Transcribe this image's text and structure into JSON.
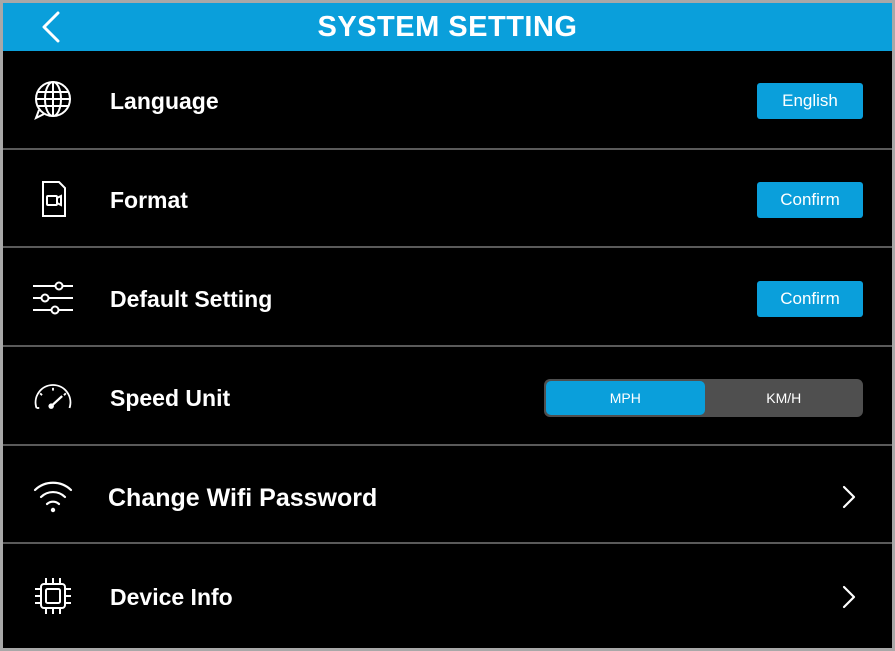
{
  "header": {
    "title": "SYSTEM SETTING",
    "back_icon": "chevron-left-icon"
  },
  "rows": [
    {
      "icon": "globe-icon",
      "label": "Language",
      "control": "button",
      "button_label": "English"
    },
    {
      "icon": "video-file-icon",
      "label": "Format",
      "control": "button",
      "button_label": "Confirm"
    },
    {
      "icon": "sliders-icon",
      "label": "Default Setting",
      "control": "button",
      "button_label": "Confirm"
    },
    {
      "icon": "speedometer-icon",
      "label": "Speed Unit",
      "control": "segmented",
      "options": [
        "MPH",
        "KM/H"
      ],
      "selected": "MPH"
    },
    {
      "icon": "wifi-icon",
      "label": "Change Wifi Password",
      "control": "chevron",
      "chevron_icon": "chevron-right-icon"
    },
    {
      "icon": "chip-icon",
      "label": "Device Info",
      "control": "chevron",
      "chevron_icon": "chevron-right-icon"
    }
  ],
  "colors": {
    "accent": "#0a9fdb",
    "background": "#000000",
    "divider": "#5a5a5a",
    "segment_inactive": "#4f4f4f",
    "text": "#ffffff"
  }
}
